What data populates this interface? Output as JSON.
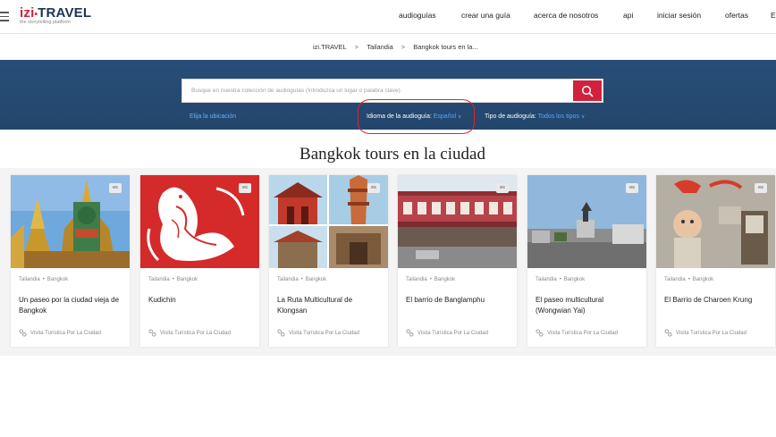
{
  "header": {
    "logo_text_izi": "izi",
    "logo_text_dot": "•",
    "logo_text_travel": "TRAVEL",
    "logo_tagline": "the storytelling platform",
    "nav": [
      {
        "label": "audioguías"
      },
      {
        "label": "crear una guía"
      },
      {
        "label": "acerca de nosotros"
      },
      {
        "label": "api"
      },
      {
        "label": "iniciar sesión"
      },
      {
        "label": "ofertas"
      },
      {
        "label": "E"
      }
    ]
  },
  "breadcrumb": {
    "items": [
      "izi.TRAVEL",
      "Tailandia",
      "Bangkok tours en la..."
    ],
    "separator": ">"
  },
  "search": {
    "placeholder": "Busque en nuestra colección de audioguías (Introduzca un lugar o palabra clave)",
    "location_link": "Elija la ubicación",
    "language_label": "Idioma de la audioguía:",
    "language_value": "Español",
    "type_label": "Tipo de audioguía:",
    "type_value": "Todos los tipos",
    "caret": "∨"
  },
  "section": {
    "title": "Bangkok tours en la ciudad"
  },
  "cards": [
    {
      "lang": "es",
      "country": "Tailandia",
      "city": "Bangkok",
      "title": "Un paseo por la ciudad vieja de Bangkok",
      "type": "Visita Turística Por La Ciudad"
    },
    {
      "lang": "es",
      "country": "Tailandia",
      "city": "Bangkok",
      "title": "Kudichin",
      "type": "Visita Turística Por La Ciudad"
    },
    {
      "lang": "es",
      "country": "Tailandia",
      "city": "Bangkok",
      "title": "La Ruta Multicultural de Klongsan",
      "type": "Visita Turística Por La Ciudad"
    },
    {
      "lang": "es",
      "country": "Tailandia",
      "city": "Bangkok",
      "title": "El barrio de Banglamphu",
      "type": "Visita Turística Por La Ciudad"
    },
    {
      "lang": "es",
      "country": "Tailandia",
      "city": "Bangkok",
      "title": "El paseo multicultural (Wongwian Yai)",
      "type": "Visita Turística Por La Ciudad"
    },
    {
      "lang": "es",
      "country": "Tailandia",
      "city": "Bangkok",
      "title": "El Barrio de Charoen Krung",
      "type": "Visita Turística Por La Ciudad"
    }
  ],
  "colors": {
    "brand_red": "#d1213c",
    "band_blue": "#264a71",
    "link_blue": "#5aa6ff"
  }
}
